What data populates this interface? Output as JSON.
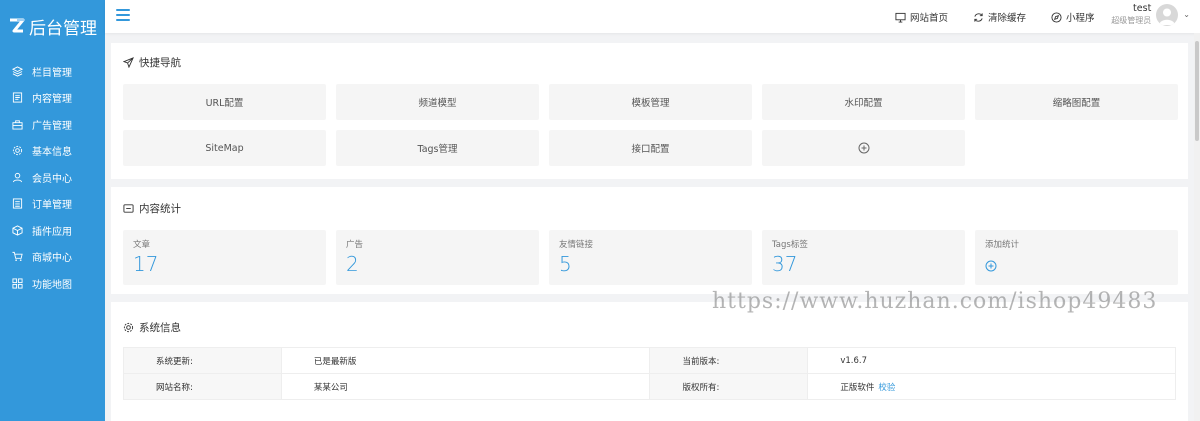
{
  "app": {
    "logo_text": "后台管理"
  },
  "sidebar": {
    "items": [
      {
        "label": "栏目管理",
        "icon": "layers-icon"
      },
      {
        "label": "内容管理",
        "icon": "document-icon"
      },
      {
        "label": "广告管理",
        "icon": "briefcase-icon"
      },
      {
        "label": "基本信息",
        "icon": "settings-icon"
      },
      {
        "label": "会员中心",
        "icon": "user-icon"
      },
      {
        "label": "订单管理",
        "icon": "list-icon"
      },
      {
        "label": "插件应用",
        "icon": "cube-icon"
      },
      {
        "label": "商城中心",
        "icon": "cart-icon"
      },
      {
        "label": "功能地图",
        "icon": "grid-icon"
      }
    ]
  },
  "header": {
    "links": [
      {
        "label": "网站首页",
        "icon": "monitor-icon"
      },
      {
        "label": "清除缓存",
        "icon": "refresh-icon"
      },
      {
        "label": "小程序",
        "icon": "compass-icon"
      }
    ],
    "user": {
      "name": "test",
      "role": "超级管理员"
    }
  },
  "quick_nav": {
    "title": "快捷导航",
    "buttons": [
      "URL配置",
      "频道模型",
      "模板管理",
      "水印配置",
      "缩略图配置",
      "SiteMap",
      "Tags管理",
      "接口配置"
    ],
    "add_icon": "plus-circle-icon"
  },
  "content_stats": {
    "title": "内容统计",
    "items": [
      {
        "label": "文章",
        "value": "17"
      },
      {
        "label": "广告",
        "value": "2"
      },
      {
        "label": "友情链接",
        "value": "5"
      },
      {
        "label": "Tags标签",
        "value": "37"
      }
    ],
    "add_label": "添加统计"
  },
  "system_info": {
    "title": "系统信息",
    "rows": [
      {
        "k1": "系统更新:",
        "v1": "已是最新版",
        "k2": "当前版本:",
        "v2": "v1.6.7"
      },
      {
        "k1": "网站名称:",
        "v1": "某某公司",
        "k2": "版权所有:",
        "v2": "正版软件",
        "v2_link": "校验"
      }
    ]
  },
  "watermark": "https://www.huzhan.com/ishop49483",
  "colors": {
    "accent": "#3398db",
    "panel_bg": "#ffffff",
    "page_bg": "#f2f3f5",
    "tile_bg": "#f5f5f5"
  }
}
